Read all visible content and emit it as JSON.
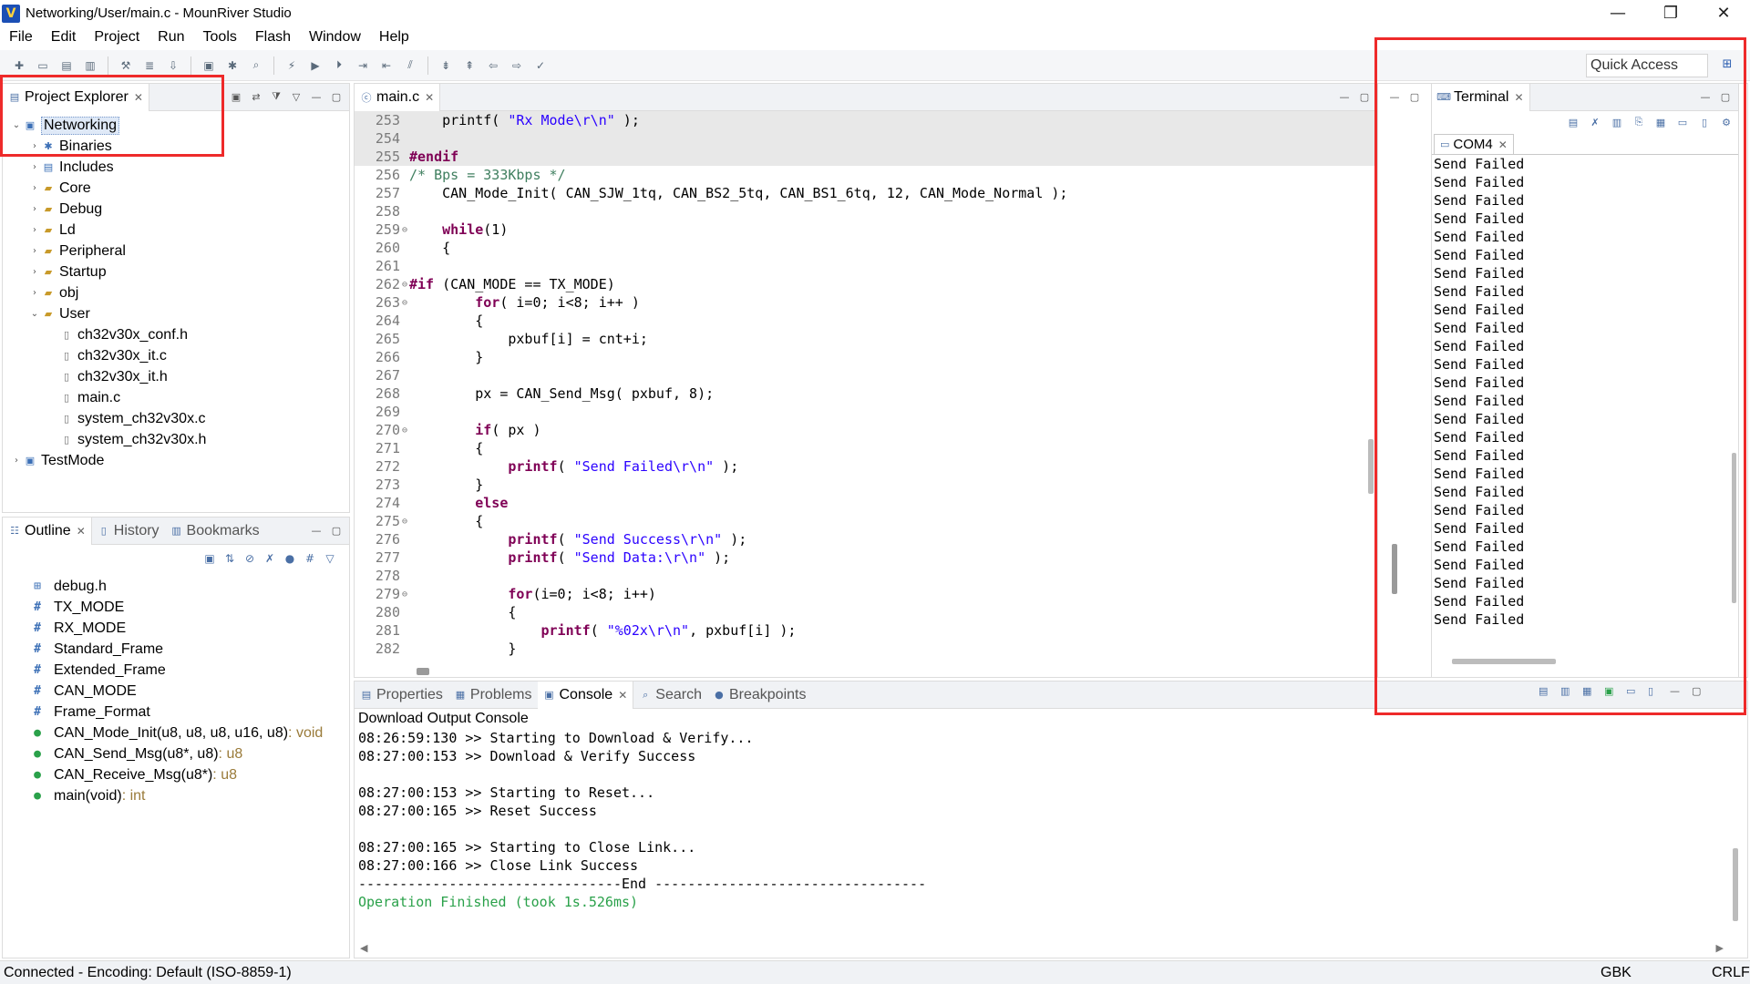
{
  "window": {
    "title": "Networking/User/main.c - MounRiver Studio",
    "logo_letter": "V",
    "minimize": "—",
    "maximize": "❐",
    "close": "✕"
  },
  "menu": [
    "File",
    "Edit",
    "Project",
    "Run",
    "Tools",
    "Flash",
    "Window",
    "Help"
  ],
  "toolbar": {
    "quick_access": "Quick Access"
  },
  "project_explorer": {
    "tab_label": "Project Explorer",
    "items": [
      {
        "label": "Networking",
        "depth": 0,
        "expanded": true,
        "kind": "project",
        "selected": true
      },
      {
        "label": "Binaries",
        "depth": 1,
        "expanded": false,
        "kind": "binaries"
      },
      {
        "label": "Includes",
        "depth": 1,
        "expanded": false,
        "kind": "includes"
      },
      {
        "label": "Core",
        "depth": 1,
        "expanded": false,
        "kind": "folder"
      },
      {
        "label": "Debug",
        "depth": 1,
        "expanded": false,
        "kind": "folder"
      },
      {
        "label": "Ld",
        "depth": 1,
        "expanded": false,
        "kind": "folder"
      },
      {
        "label": "Peripheral",
        "depth": 1,
        "expanded": false,
        "kind": "folder"
      },
      {
        "label": "Startup",
        "depth": 1,
        "expanded": false,
        "kind": "folder"
      },
      {
        "label": "obj",
        "depth": 1,
        "expanded": false,
        "kind": "folder"
      },
      {
        "label": "User",
        "depth": 1,
        "expanded": true,
        "kind": "folder"
      },
      {
        "label": "ch32v30x_conf.h",
        "depth": 2,
        "kind": "file"
      },
      {
        "label": "ch32v30x_it.c",
        "depth": 2,
        "kind": "file"
      },
      {
        "label": "ch32v30x_it.h",
        "depth": 2,
        "kind": "file"
      },
      {
        "label": "main.c",
        "depth": 2,
        "kind": "file"
      },
      {
        "label": "system_ch32v30x.c",
        "depth": 2,
        "kind": "file"
      },
      {
        "label": "system_ch32v30x.h",
        "depth": 2,
        "kind": "file"
      },
      {
        "label": "TestMode",
        "depth": 0,
        "expanded": false,
        "kind": "project"
      }
    ]
  },
  "outline": {
    "tabs": [
      "Outline",
      "History",
      "Bookmarks"
    ],
    "items": [
      {
        "kind": "include",
        "label": "debug.h",
        "type": ""
      },
      {
        "kind": "macro",
        "label": "TX_MODE",
        "type": ""
      },
      {
        "kind": "macro",
        "label": "RX_MODE",
        "type": ""
      },
      {
        "kind": "macro",
        "label": "Standard_Frame",
        "type": ""
      },
      {
        "kind": "macro",
        "label": "Extended_Frame",
        "type": ""
      },
      {
        "kind": "macro",
        "label": "CAN_MODE",
        "type": ""
      },
      {
        "kind": "macro",
        "label": "Frame_Format",
        "type": ""
      },
      {
        "kind": "function",
        "label": "CAN_Mode_Init(u8, u8, u8, u16, u8)",
        "type": " : void"
      },
      {
        "kind": "function",
        "label": "CAN_Send_Msg(u8*, u8)",
        "type": " : u8"
      },
      {
        "kind": "function",
        "label": "CAN_Receive_Msg(u8*)",
        "type": " : u8"
      },
      {
        "kind": "function",
        "label": "main(void)",
        "type": " : int"
      }
    ]
  },
  "editor": {
    "tab_label": "main.c",
    "lines": [
      {
        "n": "253",
        "fold": "",
        "hl": true,
        "html": "    printf( <span class=\"str\">\"Rx Mode\\r\\n\"</span> );"
      },
      {
        "n": "254",
        "fold": "",
        "hl": true,
        "html": ""
      },
      {
        "n": "255",
        "fold": "",
        "hl": true,
        "html": "<span class=\"pre\">#endif</span>"
      },
      {
        "n": "256",
        "fold": "",
        "hl": false,
        "html": "<span class=\"cmt\">/* Bps = 333Kbps */</span>"
      },
      {
        "n": "257",
        "fold": "",
        "hl": false,
        "html": "    CAN_Mode_Init( CAN_SJW_1tq, CAN_BS2_5tq, CAN_BS1_6tq, 12, CAN_Mode_Normal );"
      },
      {
        "n": "258",
        "fold": "",
        "hl": false,
        "html": ""
      },
      {
        "n": "259",
        "fold": "⊖",
        "hl": false,
        "html": "    <span class=\"kw\">while</span>(1)"
      },
      {
        "n": "260",
        "fold": "",
        "hl": false,
        "html": "    {"
      },
      {
        "n": "261",
        "fold": "",
        "hl": false,
        "html": ""
      },
      {
        "n": "262",
        "fold": "⊖",
        "hl": false,
        "html": "<span class=\"pre\">#if</span> (CAN_MODE == TX_MODE)"
      },
      {
        "n": "263",
        "fold": "⊖",
        "hl": false,
        "html": "        <span class=\"kw\">for</span>( i=0; i&lt;8; i++ )"
      },
      {
        "n": "264",
        "fold": "",
        "hl": false,
        "html": "        {"
      },
      {
        "n": "265",
        "fold": "",
        "hl": false,
        "html": "            pxbuf[i] = cnt+i;"
      },
      {
        "n": "266",
        "fold": "",
        "hl": false,
        "html": "        }"
      },
      {
        "n": "267",
        "fold": "",
        "hl": false,
        "html": ""
      },
      {
        "n": "268",
        "fold": "",
        "hl": false,
        "html": "        px = CAN_Send_Msg( pxbuf, 8);"
      },
      {
        "n": "269",
        "fold": "",
        "hl": false,
        "html": ""
      },
      {
        "n": "270",
        "fold": "⊖",
        "hl": false,
        "html": "        <span class=\"kw\">if</span>( px )"
      },
      {
        "n": "271",
        "fold": "",
        "hl": false,
        "html": "        {"
      },
      {
        "n": "272",
        "fold": "",
        "hl": false,
        "html": "            <span class=\"kw\">printf</span>( <span class=\"str\">\"Send Failed\\r\\n\"</span> );"
      },
      {
        "n": "273",
        "fold": "",
        "hl": false,
        "html": "        }"
      },
      {
        "n": "274",
        "fold": "",
        "hl": false,
        "html": "        <span class=\"kw\">else</span>"
      },
      {
        "n": "275",
        "fold": "⊖",
        "hl": false,
        "html": "        {"
      },
      {
        "n": "276",
        "fold": "",
        "hl": false,
        "html": "            <span class=\"kw\">printf</span>( <span class=\"str\">\"Send Success\\r\\n\"</span> );"
      },
      {
        "n": "277",
        "fold": "",
        "hl": false,
        "html": "            <span class=\"kw\">printf</span>( <span class=\"str\">\"Send Data:\\r\\n\"</span> );"
      },
      {
        "n": "278",
        "fold": "",
        "hl": false,
        "html": ""
      },
      {
        "n": "279",
        "fold": "⊖",
        "hl": false,
        "html": "            <span class=\"kw\">for</span>(i=0; i&lt;8; i++)"
      },
      {
        "n": "280",
        "fold": "",
        "hl": false,
        "html": "            {"
      },
      {
        "n": "281",
        "fold": "",
        "hl": false,
        "html": "                <span class=\"kw\">printf</span>( <span class=\"str\">\"%02x\\r\\n\"</span>, pxbuf[i] );"
      },
      {
        "n": "282",
        "fold": "",
        "hl": false,
        "html": "            }"
      }
    ]
  },
  "bottom_panel": {
    "tabs": [
      "Properties",
      "Problems",
      "Console",
      "Search",
      "Breakpoints"
    ],
    "active_tab": "Console",
    "console_title": "Download Output Console",
    "lines": [
      {
        "text": "08:26:59:130 >> Starting to Download & Verify...",
        "green": false
      },
      {
        "text": "08:27:00:153 >> Download & Verify Success",
        "green": false
      },
      {
        "text": "",
        "green": false
      },
      {
        "text": "08:27:00:153 >> Starting to Reset...",
        "green": false
      },
      {
        "text": "08:27:00:165 >> Reset Success",
        "green": false
      },
      {
        "text": "",
        "green": false
      },
      {
        "text": "08:27:00:165 >> Starting to Close Link...",
        "green": false
      },
      {
        "text": "08:27:00:166 >> Close Link Success",
        "green": false
      },
      {
        "text": "--------------------------------End ---------------------------------",
        "green": false
      },
      {
        "text": "Operation Finished (took 1s.526ms)",
        "green": true
      }
    ]
  },
  "terminal": {
    "tab_label": "Terminal",
    "session_tab": "COM4",
    "lines": [
      "Send Failed",
      "Send Failed",
      "Send Failed",
      "Send Failed",
      "Send Failed",
      "Send Failed",
      "Send Failed",
      "Send Failed",
      "Send Failed",
      "Send Failed",
      "Send Failed",
      "Send Failed",
      "Send Failed",
      "Send Failed",
      "Send Failed",
      "Send Failed",
      "Send Failed",
      "Send Failed",
      "Send Failed",
      "Send Failed",
      "Send Failed",
      "Send Failed",
      "Send Failed",
      "Send Failed",
      "Send Failed",
      "Send Failed"
    ]
  },
  "status": {
    "left": "Connected - Encoding: Default (ISO-8859-1)",
    "encoding": "GBK",
    "line_ending": "CRLF"
  },
  "colors": {
    "highlight_box": "#ee2a2a",
    "keyword": "#7f0055",
    "string": "#2a00ff",
    "comment": "#3f7f5f",
    "success_text": "#2aa14a"
  }
}
